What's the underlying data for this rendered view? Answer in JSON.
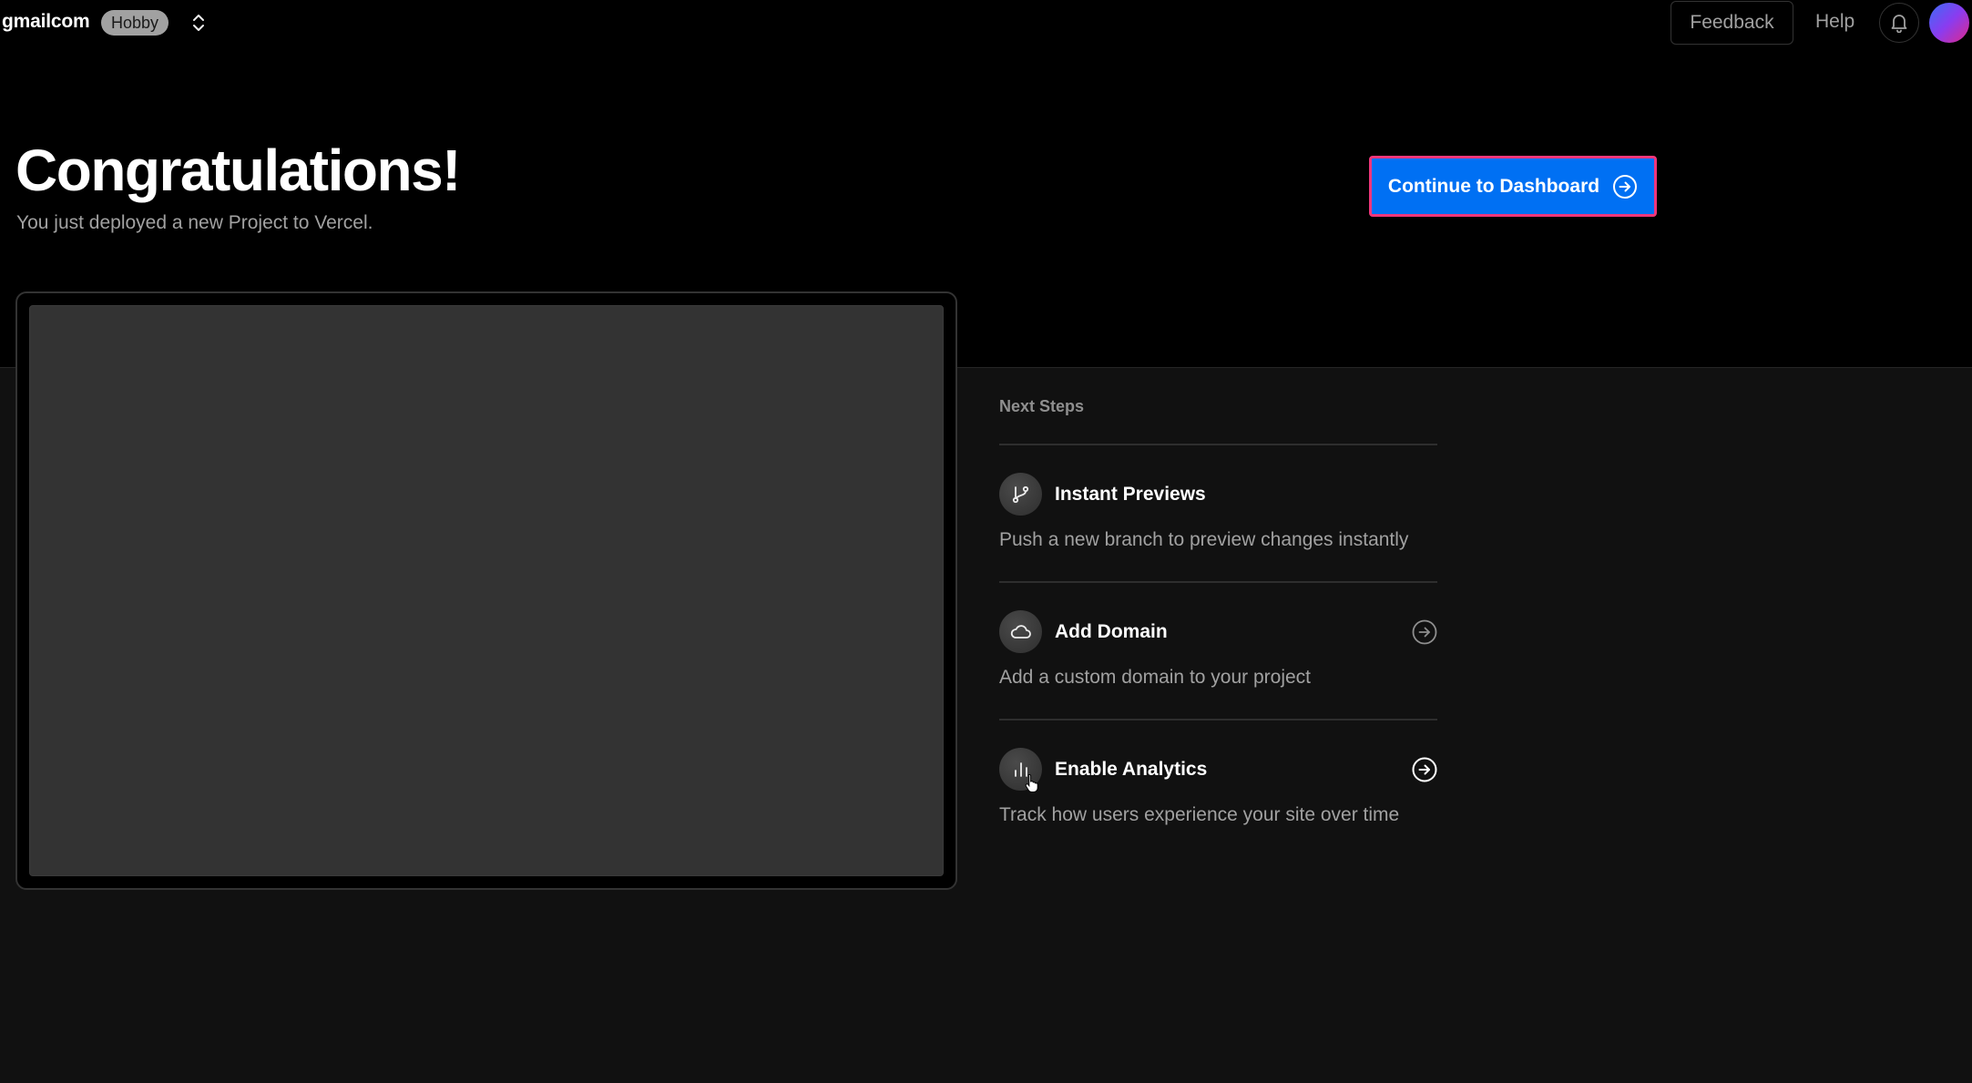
{
  "header": {
    "team_name": "gmailcom",
    "plan_badge": "Hobby",
    "switcher_icon": "chevron-up-down-icon",
    "feedback_label": "Feedback",
    "help_label": "Help",
    "notifications_icon": "bell-icon",
    "avatar_icon": "user-avatar"
  },
  "hero": {
    "title": "Congratulations!",
    "subtitle": "You just deployed a new Project to Vercel.",
    "continue_label": "Continue to Dashboard",
    "continue_icon": "arrow-right-circle-icon"
  },
  "next_steps": {
    "title": "Next Steps",
    "items": [
      {
        "title": "Instant Previews",
        "description": "Push a new branch to preview changes instantly",
        "icon": "git-branch-icon",
        "has_arrow": false
      },
      {
        "title": "Add Domain",
        "description": "Add a custom domain to your project",
        "icon": "cloud-icon",
        "has_arrow": true
      },
      {
        "title": "Enable Analytics",
        "description": "Track how users experience your site over time",
        "icon": "bar-chart-icon",
        "has_arrow": true
      }
    ]
  },
  "colors": {
    "accent": "#0070f3",
    "focus_ring": "#f0367a",
    "background_top": "#000000",
    "background_bottom": "#111111"
  }
}
